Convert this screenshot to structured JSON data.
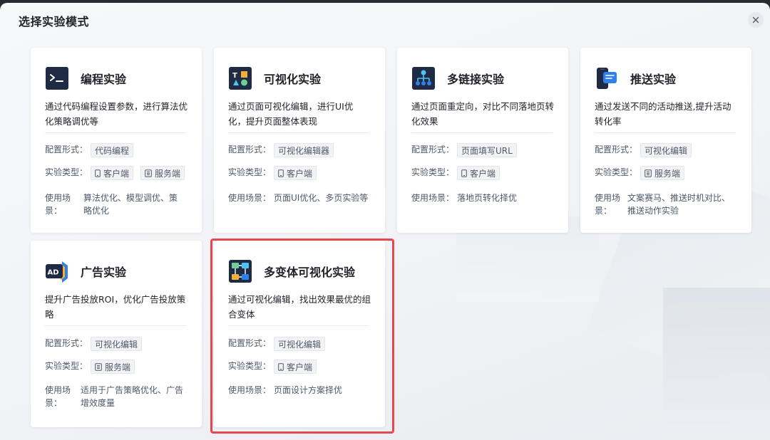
{
  "dialog": {
    "title": "选择实验模式"
  },
  "labels": {
    "config": "配置形式：",
    "type": "实验类型：",
    "scene": "使用场景：",
    "scene_wrapped": "使用场景："
  },
  "cards": [
    {
      "name": "编程实验",
      "icon": "terminal-icon",
      "desc": "通过代码编程设置参数，进行算法优化策略调优等",
      "config": "代码编程",
      "types": [
        "客户端",
        "服务端"
      ],
      "scene": "算法优化、模型调优、策略优化"
    },
    {
      "name": "可视化实验",
      "icon": "visual-shapes-icon",
      "desc": "通过页面可视化编辑，进行UI优化，提升页面整体表现",
      "config": "可视化编辑器",
      "types": [
        "客户端"
      ],
      "scene": "页面UI优化、多页实验等"
    },
    {
      "name": "多链接实验",
      "icon": "multi-link-icon",
      "desc": "通过页面重定向，对比不同落地页转化效果",
      "config": "页面填写URL",
      "types": [
        "客户端"
      ],
      "scene": "落地页转化择优"
    },
    {
      "name": "推送实验",
      "icon": "push-message-icon",
      "desc": "通过发送不同的活动推送,提升活动转化率",
      "config": "可视化编辑",
      "types": [
        "服务端"
      ],
      "scene": "文案赛马、推送时机对比、推送动作实验"
    },
    {
      "name": "广告实验",
      "icon": "ad-icon",
      "desc": "提升广告投放ROI，优化广告投放策略",
      "config": "可视化编辑",
      "types": [
        "服务端"
      ],
      "scene": "适用于广告策略优化、广告增效度量"
    },
    {
      "name": "多变体可视化实验",
      "icon": "multi-variant-icon",
      "desc": "通过可视化编辑，找出效果最优的组合变体",
      "config": "可视化编辑",
      "types": [
        "客户端"
      ],
      "scene": "页面设计方案择优"
    }
  ],
  "colors": {
    "accent_red": "#e5484d",
    "icon_dark": "#1f2a44",
    "icon_blue": "#2f80ed"
  }
}
